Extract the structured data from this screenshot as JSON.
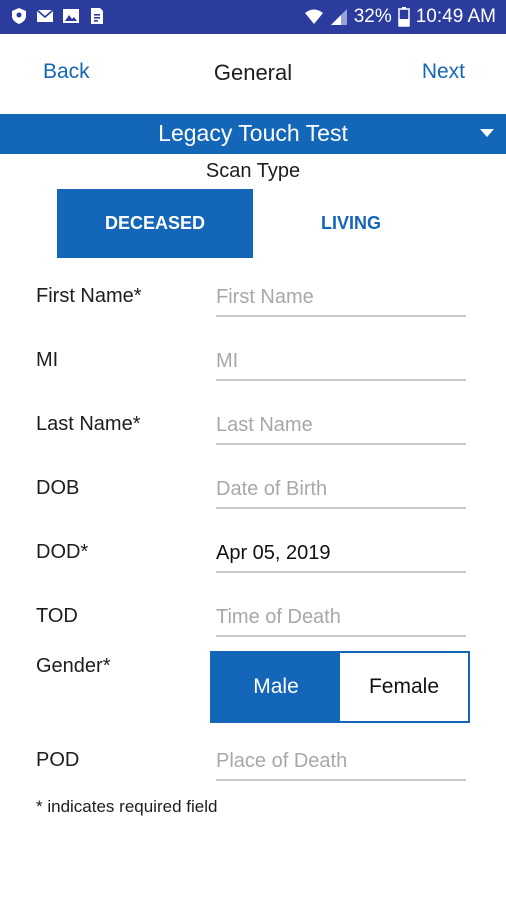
{
  "statusbar": {
    "battery": "32%",
    "time": "10:49 AM",
    "icons": [
      "shield-icon",
      "mail-icon",
      "image-icon",
      "document-icon",
      "wifi-icon",
      "signal-icon",
      "battery-icon"
    ]
  },
  "nav": {
    "back": "Back",
    "title": "General",
    "next": "Next"
  },
  "location": {
    "name": "Legacy Touch Test",
    "icon": "dropdown-arrow-icon"
  },
  "scan": {
    "label": "Scan Type",
    "options": [
      "DECEASED",
      "LIVING"
    ],
    "selected": "DECEASED"
  },
  "form": {
    "first_name": {
      "label": "First Name*",
      "placeholder": "First Name",
      "value": ""
    },
    "mi": {
      "label": "MI",
      "placeholder": "MI",
      "value": ""
    },
    "last_name": {
      "label": "Last Name*",
      "placeholder": "Last Name",
      "value": ""
    },
    "dob": {
      "label": "DOB",
      "placeholder": "Date of Birth",
      "value": ""
    },
    "dod": {
      "label": "DOD*",
      "placeholder": "",
      "value": "Apr 05, 2019"
    },
    "tod": {
      "label": "TOD",
      "placeholder": "Time of Death",
      "value": ""
    },
    "gender": {
      "label": "Gender*",
      "options": [
        "Male",
        "Female"
      ],
      "selected": "Male"
    },
    "pod": {
      "label": "POD",
      "placeholder": "Place of Death",
      "value": ""
    }
  },
  "note": "* indicates required field",
  "colors": {
    "statusbar": "#2b3b9e",
    "primary": "#1467b8",
    "underline": "#c9c9c9"
  }
}
